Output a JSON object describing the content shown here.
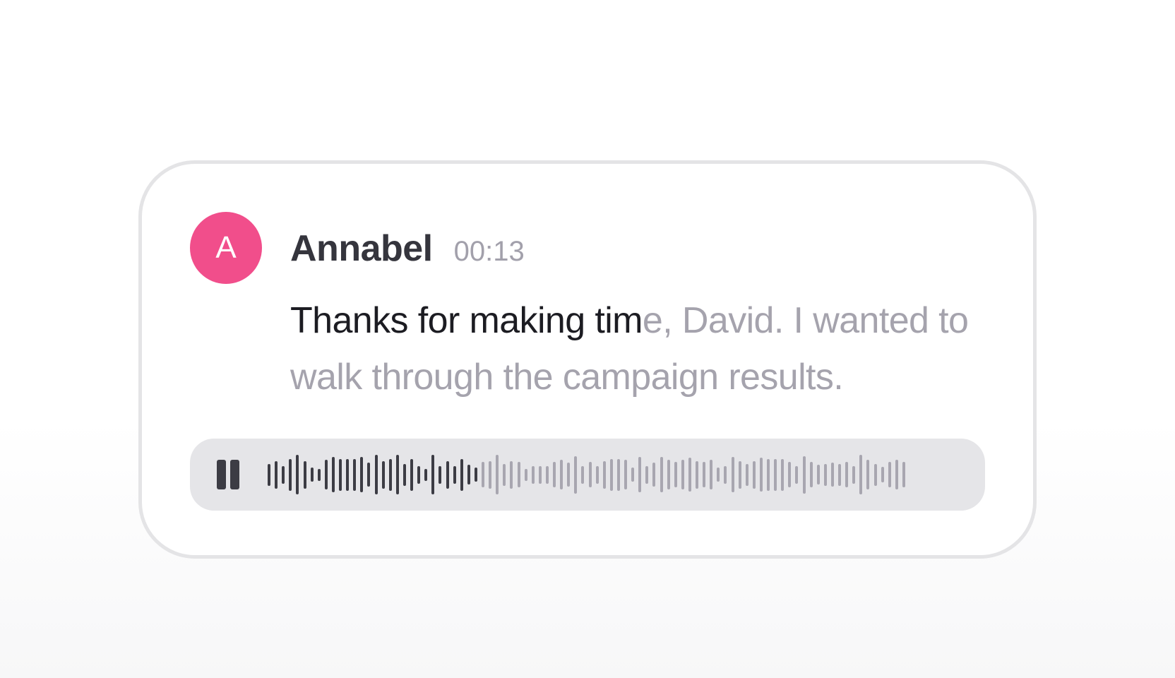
{
  "message": {
    "avatar_initial": "A",
    "author": "Annabel",
    "timestamp": "00:13",
    "text_spoken": "Thanks for making tim",
    "text_pending": "e, David. I wanted to walk through the campaign results.",
    "colors": {
      "avatar": "#f14e8b",
      "author": "#35353d",
      "timestamp": "#a2a0ab",
      "text_spoken": "#1c1c22",
      "text_pending": "#a5a3ad"
    }
  },
  "player": {
    "state": "playing",
    "control_icon": "pause-icon",
    "progress": 0.33,
    "colors": {
      "background": "#e5e5e8",
      "played": "#3c3c44",
      "unplayed": "#a8a6b0"
    },
    "waveform_levels": [
      0.55,
      0.7,
      0.45,
      0.8,
      1.0,
      0.7,
      0.35,
      0.3,
      0.75,
      0.9,
      0.8,
      0.8,
      0.8,
      0.9,
      0.6,
      1.0,
      0.7,
      0.8,
      1.0,
      0.55,
      0.8,
      0.45,
      0.3,
      1.0,
      0.45,
      0.7,
      0.45,
      0.8,
      0.5,
      0.35,
      0.65,
      0.7,
      1.0,
      0.55,
      0.7,
      0.65,
      0.3,
      0.45,
      0.45,
      0.45,
      0.65,
      0.75,
      0.6,
      0.95,
      0.45,
      0.65,
      0.45,
      0.7,
      0.8,
      0.8,
      0.75,
      0.35,
      0.9,
      0.45,
      0.6,
      0.9,
      0.75,
      0.65,
      0.75,
      0.85,
      0.7,
      0.65,
      0.75,
      0.35,
      0.45,
      0.9,
      0.7,
      0.55,
      0.7,
      0.85,
      0.8,
      0.8,
      0.8,
      0.65,
      0.45,
      0.95,
      0.65,
      0.5,
      0.55,
      0.6,
      0.55,
      0.65,
      0.45,
      1.0,
      0.75,
      0.55,
      0.4,
      0.65,
      0.75,
      0.65
    ]
  }
}
